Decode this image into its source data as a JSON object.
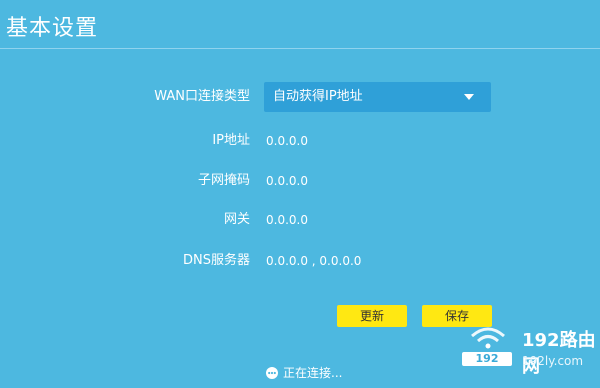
{
  "page": {
    "title": "基本设置"
  },
  "form": {
    "wan_type_label": "WAN口连接类型",
    "wan_type_value": "自动获得IP地址",
    "ip_label": "IP地址",
    "ip_value": "0.0.0.0",
    "subnet_label": "子网掩码",
    "subnet_value": "0.0.0.0",
    "gateway_label": "网关",
    "gateway_value": "0.0.0.0",
    "dns_label": "DNS服务器",
    "dns_value": "0.0.0.0 , 0.0.0.0"
  },
  "buttons": {
    "refresh_label": "更新",
    "save_label": "保存"
  },
  "status": {
    "text": "正在连接..."
  },
  "watermark": {
    "brand": "192路由网",
    "site": "192ly.com",
    "tag": "192"
  },
  "colors": {
    "background": "#4db8e0",
    "select": "#2fa0d8",
    "button": "#ffe812"
  }
}
